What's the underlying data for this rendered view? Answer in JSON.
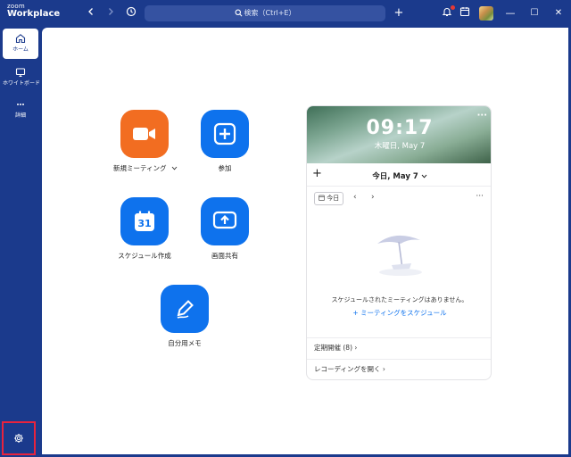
{
  "app": {
    "brand_small": "zoom",
    "brand_big": "Workplace"
  },
  "titlebar": {
    "back_icon": "chevron-left-icon",
    "forward_icon": "chevron-right-icon",
    "history_icon": "history-icon",
    "search_placeholder": "検索（Ctrl+E）",
    "plus_label": "+",
    "minimize_label": "—",
    "maximize_label": "☐",
    "close_label": "✕"
  },
  "sidebar": {
    "items": [
      {
        "label": "ホーム",
        "icon": "home-icon"
      },
      {
        "label": "ホワイトボード",
        "icon": "whiteboard-icon"
      },
      {
        "label": "詳細",
        "icon": "more-icon"
      }
    ],
    "settings_icon": "gear-icon"
  },
  "actions": {
    "new_meeting": "新規ミーティング",
    "join": "参加",
    "schedule": "スケジュール作成",
    "schedule_day": "31",
    "share_screen": "画面共有",
    "notes": "自分用メモ"
  },
  "calendar": {
    "time": "09:17",
    "date": "木曜日, May 7",
    "header_today": "今日, May 7",
    "today_button": "今日",
    "empty_text": "スケジュールされたミーティングはありません。",
    "schedule_link": "ミーティングをスケジュール",
    "recurring": "定期開催 (8)",
    "recordings": "レコーディングを開く"
  },
  "colors": {
    "brand_blue": "#1b3a8c",
    "action_blue": "#0e72ed",
    "action_orange": "#f26d21",
    "highlight_red": "#e8233d"
  }
}
